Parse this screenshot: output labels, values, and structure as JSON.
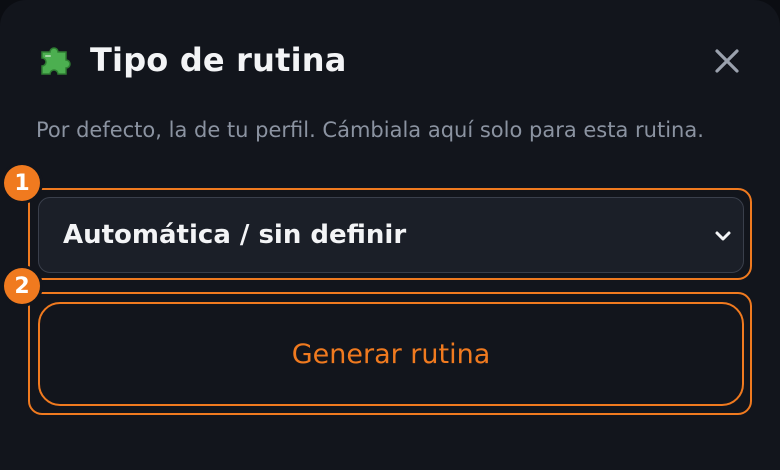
{
  "dialog": {
    "title": "Tipo de rutina",
    "title_icon": "puzzle-piece-icon",
    "close_icon": "close-icon",
    "description": "Por defecto, la de tu perfil. Cámbiala aquí solo para esta rutina."
  },
  "routine_type_select": {
    "selected_value": "Automática / sin definir",
    "chevron_icon": "chevron-down-icon"
  },
  "generate_button": {
    "label": "Generar rutina"
  },
  "markers": [
    "1",
    "2"
  ],
  "colors": {
    "accent": "#f07a1f",
    "background": "#12151c",
    "text": "#f3f4f6",
    "muted_text": "#8b93a1",
    "puzzle": "#4caf50"
  }
}
